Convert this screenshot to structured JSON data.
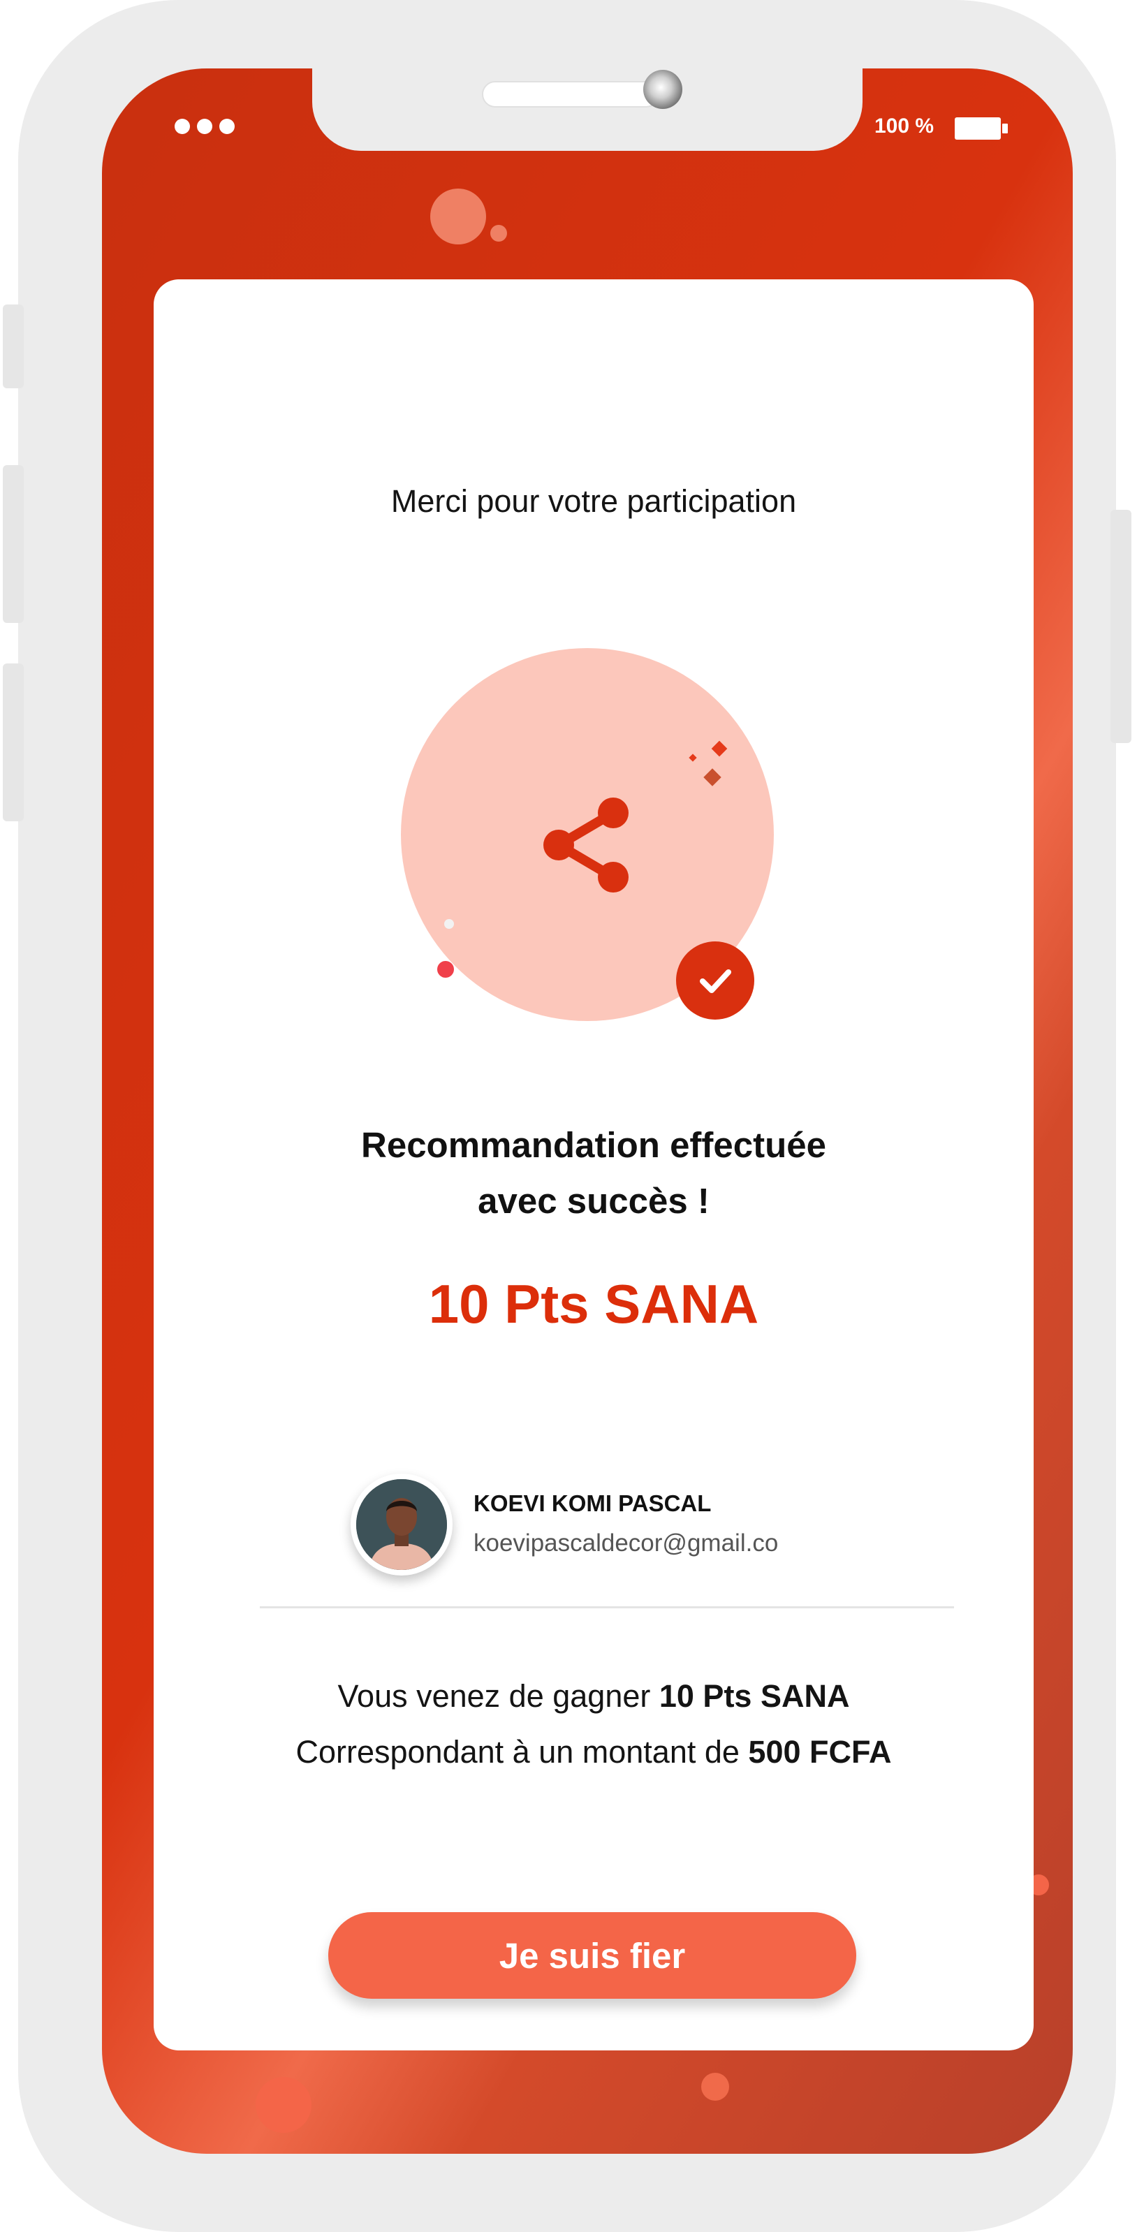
{
  "status_bar": {
    "battery_label": "100 %"
  },
  "card": {
    "thanks_text": "Merci pour votre participation",
    "illustration_icon": "share-icon",
    "badge_icon": "check-icon",
    "headline_line1": "Recommandation effectuée",
    "headline_line2": "avec succès !",
    "points": "10 Pts SANA",
    "user": {
      "name": "KOEVI KOMI PASCAL",
      "email": "koevipascaldecor@gmail.co"
    },
    "info": {
      "line1_prefix": "Vous venez de gagner ",
      "line1_bold": "10 Pts SANA",
      "line2_prefix": "Correspondant  à un montant de ",
      "line2_bold": "500 FCFA"
    },
    "cta_label": "Je suis fier"
  },
  "colors": {
    "brand_red": "#dc2e0a",
    "button_orange": "#f46548",
    "illustration_pink": "#fcc7bb"
  }
}
